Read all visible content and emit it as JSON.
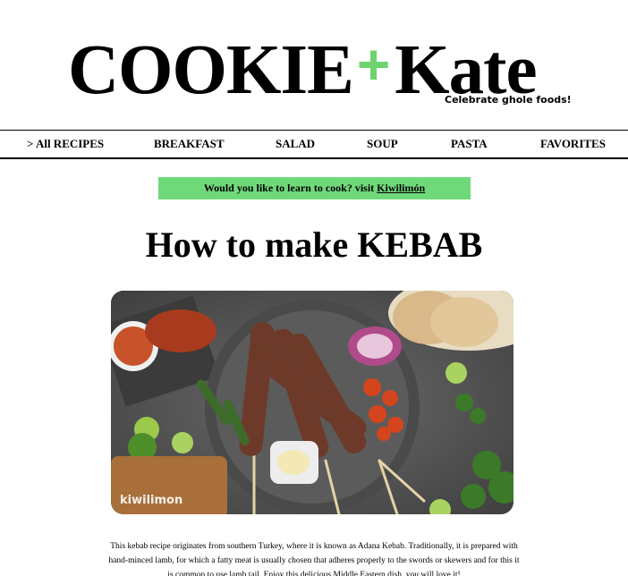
{
  "brand": {
    "name_left": "COOKIE",
    "plus": "+",
    "name_right": "Kate",
    "tagline": "Celebrate ghole foods!",
    "accent": "#6fd36f"
  },
  "nav": {
    "items": [
      {
        "label": "> All RECIPES"
      },
      {
        "label": "BREAKFAST"
      },
      {
        "label": "SALAD"
      },
      {
        "label": "SOUP"
      },
      {
        "label": "PASTA"
      },
      {
        "label": "FAVORITES"
      }
    ]
  },
  "promo": {
    "text": "Would you like to learn to cook? visit",
    "link": "Kiwilimón",
    "background": "#6fd97a"
  },
  "article": {
    "title": "How to make KEBAB",
    "image_watermark": "kiwilimon",
    "description": "This kebab recipe originates from southern Turkey, where it is known as Adana Kebab. Traditionally, it is prepared with hand-minced lamb, for which a fatty meat is usually chosen that adheres properly to the swords or skewers and for this it is common to use lamb tail. Enjoy this delicious Middle Eastern dish, you will love it!"
  }
}
